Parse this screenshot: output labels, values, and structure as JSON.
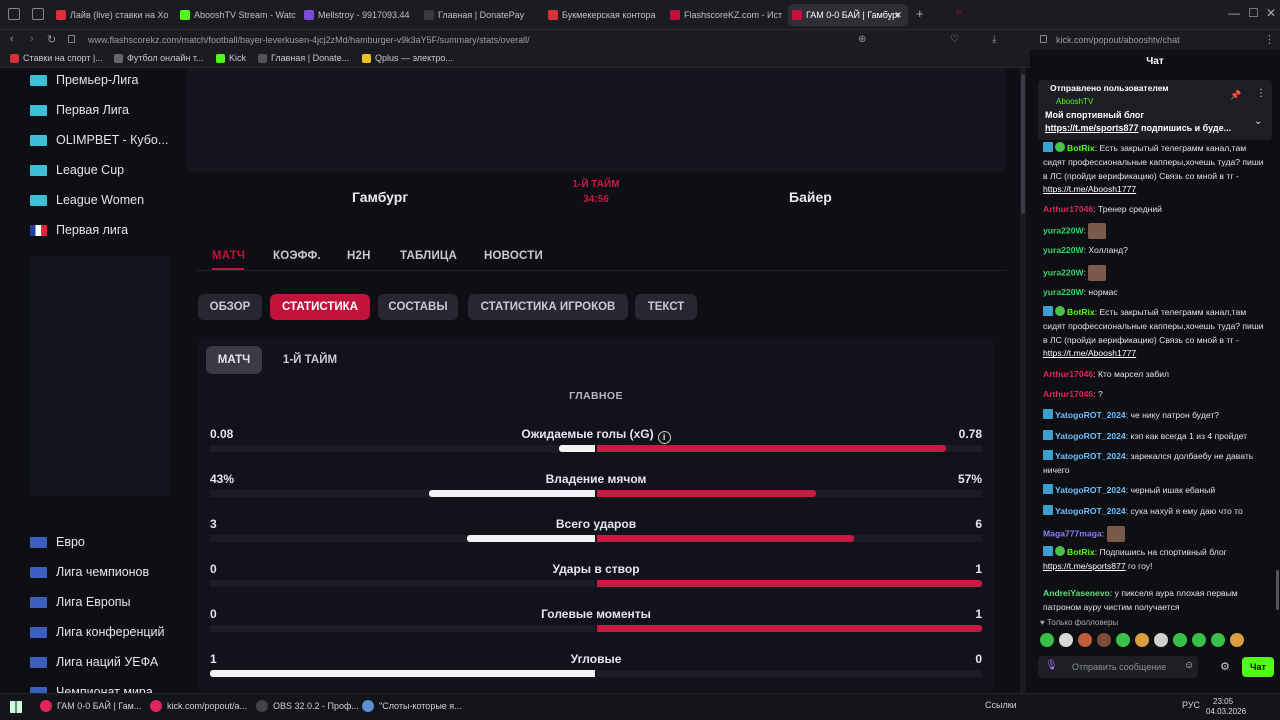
{
  "tabs": [
    {
      "label": "Лайв (live) ставки на Хо",
      "color": "#d9303a"
    },
    {
      "label": "AbooshTV Stream - Watc",
      "color": "#53fc18"
    },
    {
      "label": "Mellstroy - 9917093.44",
      "color": "#7a4bd8"
    },
    {
      "label": "Главная | DonatePay",
      "color": "#3a3a3a"
    },
    {
      "label": "Букмекерская контора",
      "color": "#d9303a"
    },
    {
      "label": "FlashscoreKZ.com - Ист",
      "color": "#c2123b"
    },
    {
      "label": "ГАМ 0-0 БАЙ | Гамбург",
      "color": "#c2123b"
    }
  ],
  "address": {
    "url": "www.flashscorekz.com/match/football/bayer-leverkusen-4jcj2zMd/hamburger-v9k3aY5F/summary/stats/overall/",
    "chat_url": "kick.com/popout/abooshtv/chat"
  },
  "bookmarks": [
    {
      "label": "Ставки на спорт |...",
      "color": "#d9303a"
    },
    {
      "label": "Футбол онлайн т...",
      "color": "#666"
    },
    {
      "label": "Kick",
      "color": "#53fc18"
    },
    {
      "label": "Главная | Donate...",
      "color": "#555"
    },
    {
      "label": "Qplus — электро...",
      "color": "#f0c020"
    }
  ],
  "sidebar": {
    "leagues_top": [
      {
        "label": "Премьер-Лига",
        "flag": "kz"
      },
      {
        "label": "Первая Лига",
        "flag": "kz"
      },
      {
        "label": "OLIMPBET - Кубо...",
        "flag": "kz"
      },
      {
        "label": "League Cup",
        "flag": "kz"
      },
      {
        "label": "League Women",
        "flag": "kz"
      },
      {
        "label": "Первая лига",
        "flag": "fr"
      }
    ],
    "leagues_bottom": [
      {
        "label": "Евро"
      },
      {
        "label": "Лига чемпионов"
      },
      {
        "label": "Лига Европы"
      },
      {
        "label": "Лига конференций"
      },
      {
        "label": "Лига наций УЕФА"
      },
      {
        "label": "Чемпионат мира"
      }
    ]
  },
  "match": {
    "home": "Гамбург",
    "away": "Байер",
    "period": "1-Й ТАЙМ",
    "clock": "34:56"
  },
  "nav": [
    "МАТЧ",
    "КОЭФФ.",
    "H2H",
    "ТАБЛИЦА",
    "НОВОСТИ"
  ],
  "subtabs": [
    "ОБЗОР",
    "СТАТИСТИКА",
    "СОСТАВЫ",
    "СТАТИСТИКА ИГРОКОВ",
    "ТЕКСТ"
  ],
  "period_tabs": [
    "МАТЧ",
    "1-Й ТАЙМ"
  ],
  "section_title": "ГЛАВНОЕ",
  "stats": [
    {
      "label": "Ожидаемые голы (xG)",
      "home": "0.08",
      "away": "0.78",
      "home_share": 0.093,
      "away_share": 0.907,
      "info": true
    },
    {
      "label": "Владение мячом",
      "home": "43%",
      "away": "57%",
      "home_share": 0.43,
      "away_share": 0.57
    },
    {
      "label": "Всего ударов",
      "home": "3",
      "away": "6",
      "home_share": 0.333,
      "away_share": 0.667
    },
    {
      "label": "Удары в створ",
      "home": "0",
      "away": "1",
      "home_share": 0.0,
      "away_share": 1.0
    },
    {
      "label": "Голевые моменты",
      "home": "0",
      "away": "1",
      "home_share": 0.0,
      "away_share": 1.0
    },
    {
      "label": "Угловые",
      "home": "1",
      "away": "0",
      "home_share": 1.0,
      "away_share": 0.0
    }
  ],
  "chat": {
    "header": "Чат",
    "pinned": {
      "by": "Отправлено пользователем",
      "user": "AbooshTV",
      "text": "Мой спортивный блог",
      "link": "https://t.me/sports877",
      "tail": "подпишись и буде..."
    },
    "messages": [
      {
        "user": "BotRix",
        "color": "#53fc18",
        "badges": [
          "bot",
          "verified"
        ],
        "text": "Есть закрытый телеграмм канал,там сидят профессиональные капперы,хочешь туда? пиши в ЛС (пройди верификацию) Связь со мной в тг - ",
        "link": "https://t.me/Aboosh1777"
      },
      {
        "user": "Arthur17046",
        "color": "#e0245e",
        "text": "Тренер средний"
      },
      {
        "user": "yura220W",
        "color": "#3ad16a",
        "emote": true
      },
      {
        "user": "yura220W",
        "color": "#3ad16a",
        "text": "Холланд?"
      },
      {
        "user": "yura220W",
        "color": "#3ad16a",
        "emote": true
      },
      {
        "user": "yura220W",
        "color": "#3ad16a",
        "text": "нормас"
      },
      {
        "user": "BotRix",
        "color": "#53fc18",
        "badges": [
          "bot",
          "verified"
        ],
        "text": "Есть закрытый телеграмм канал,там сидят профессиональные капперы,хочешь туда? пиши в ЛС (пройди верификацию) Связь со мной в тг - ",
        "link": "https://t.me/Aboosh1777"
      },
      {
        "user": "Arthur17046",
        "color": "#e0245e",
        "text": "Кто марсел забил"
      },
      {
        "user": "Arthur17046",
        "color": "#e0245e",
        "text": "?"
      },
      {
        "user": "YatogoROT_2024",
        "color": "#6fc0ff",
        "badges": [
          "sub"
        ],
        "text": "че нику патрон будет?"
      },
      {
        "user": "YatogoROT_2024",
        "color": "#6fc0ff",
        "badges": [
          "sub"
        ],
        "text": "кэп как всегда 1 из 4 пройдет"
      },
      {
        "user": "YatogoROT_2024",
        "color": "#6fc0ff",
        "badges": [
          "sub"
        ],
        "text": "зарекался долбаебу не давать ничего"
      },
      {
        "user": "YatogoROT_2024",
        "color": "#6fc0ff",
        "badges": [
          "sub"
        ],
        "text": "черный ишак ебаный"
      },
      {
        "user": "YatogoROT_2024",
        "color": "#6fc0ff",
        "badges": [
          "sub"
        ],
        "text": "сука нахуй я ему даю что то"
      },
      {
        "user": "Maga777maga",
        "color": "#8a7dff",
        "emote": true
      },
      {
        "user": "BotRix",
        "color": "#53fc18",
        "badges": [
          "bot",
          "verified"
        ],
        "text": "Подпишись на спортивный блог ",
        "link": "https://t.me/sports877",
        "tail": " го гоу!"
      },
      {
        "user": "AndreiYasenevo",
        "color": "#5ee07a",
        "text": "у пикселя аура плохая первым патроном ауру чистим получается"
      }
    ],
    "followers_only": "Только фолловеры",
    "input_placeholder": "Отправить сообщение",
    "send_label": "Чат"
  },
  "taskbar": {
    "items": [
      {
        "label": "ГАМ 0-0 БАЙ | Гам...",
        "color": "#e0245e"
      },
      {
        "label": "kick.com/popout/a...",
        "color": "#e0245e"
      },
      {
        "label": "OBS 32.0.2 - Проф...",
        "color": "#444"
      },
      {
        "label": "\"Слоты-которые я...",
        "color": "#5b8fd6"
      }
    ],
    "links": "Ссылки",
    "lang": "РУС",
    "time": "23:05",
    "date": "04.03.2026"
  },
  "colors": {
    "accent": "#c2123b",
    "home_bar": "#f2f2f5",
    "away_bar": "#c81a43",
    "kick_green": "#53fc18"
  }
}
